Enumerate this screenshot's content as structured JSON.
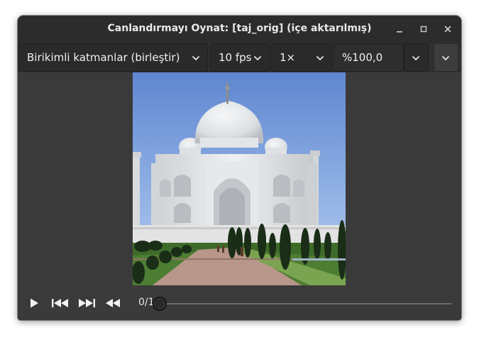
{
  "window": {
    "title": "Canlandırmayı Oynat: [taj_orig] (içe aktarılmış)"
  },
  "toolbar": {
    "layer_mode": "Birikimli katmanlar (birleştir)",
    "fps": "10 fps",
    "speed": "1×",
    "zoom": "%100,0"
  },
  "playback": {
    "frame_counter": "0/1",
    "progress": 0
  },
  "colors": {
    "window_bg": "#3a3a3a",
    "titlebar_bg": "#2c2c2c",
    "text": "#f0f0f0"
  },
  "icons": {
    "minimize": "minimize-icon",
    "maximize": "maximize-icon",
    "close": "close-icon",
    "dropdown": "chevron-down-icon",
    "play": "play-icon",
    "first_frame": "skip-to-start-icon",
    "last_frame": "skip-to-end-icon",
    "rewind": "rewind-icon"
  }
}
